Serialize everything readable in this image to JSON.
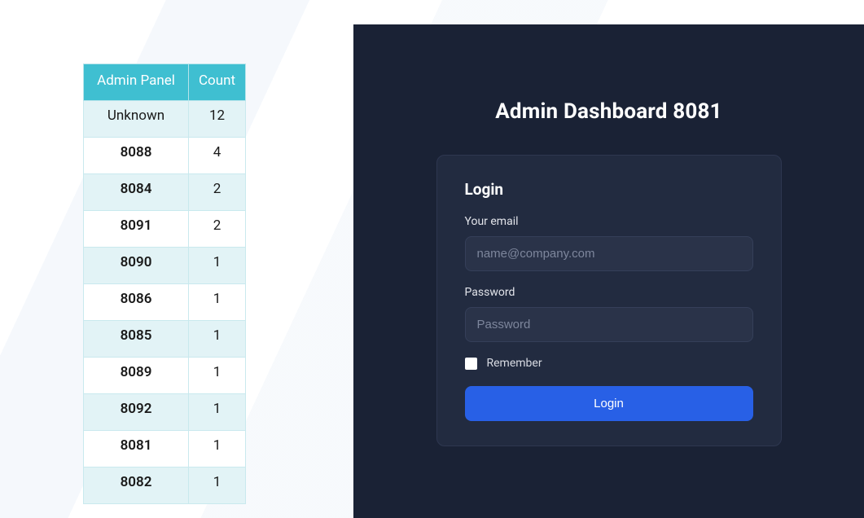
{
  "table": {
    "headers": {
      "col1": "Admin Panel",
      "col2": "Count"
    },
    "rows": [
      {
        "panel": "Unknown",
        "count": "12"
      },
      {
        "panel": "8088",
        "count": "4"
      },
      {
        "panel": "8084",
        "count": "2"
      },
      {
        "panel": "8091",
        "count": "2"
      },
      {
        "panel": "8090",
        "count": "1"
      },
      {
        "panel": "8086",
        "count": "1"
      },
      {
        "panel": "8085",
        "count": "1"
      },
      {
        "panel": "8089",
        "count": "1"
      },
      {
        "panel": "8092",
        "count": "1"
      },
      {
        "panel": "8081",
        "count": "1"
      },
      {
        "panel": "8082",
        "count": "1"
      }
    ]
  },
  "dashboard": {
    "title": "Admin Dashboard 8081",
    "login": {
      "heading": "Login",
      "email_label": "Your email",
      "email_placeholder": "name@company.com",
      "password_label": "Password",
      "password_placeholder": "Password",
      "remember_label": "Remember",
      "submit_label": "Login"
    }
  }
}
